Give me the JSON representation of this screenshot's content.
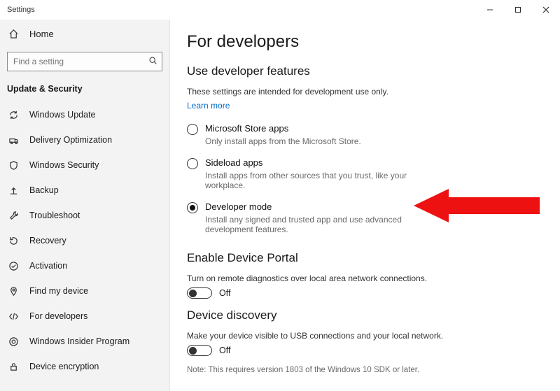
{
  "app_title": "Settings",
  "home_label": "Home",
  "search_placeholder": "Find a setting",
  "category": "Update & Security",
  "sidebar_items": [
    {
      "id": "windows-update",
      "label": "Windows Update"
    },
    {
      "id": "delivery-optimization",
      "label": "Delivery Optimization"
    },
    {
      "id": "windows-security",
      "label": "Windows Security"
    },
    {
      "id": "backup",
      "label": "Backup"
    },
    {
      "id": "troubleshoot",
      "label": "Troubleshoot"
    },
    {
      "id": "recovery",
      "label": "Recovery"
    },
    {
      "id": "activation",
      "label": "Activation"
    },
    {
      "id": "find-my-device",
      "label": "Find my device"
    },
    {
      "id": "for-developers",
      "label": "For developers"
    },
    {
      "id": "windows-insider",
      "label": "Windows Insider Program"
    },
    {
      "id": "device-encryption",
      "label": "Device encryption"
    }
  ],
  "page": {
    "title": "For developers",
    "dev_features": {
      "heading": "Use developer features",
      "desc": "These settings are intended for development use only.",
      "link": "Learn more",
      "options": [
        {
          "id": "ms-store",
          "label": "Microsoft Store apps",
          "desc": "Only install apps from the Microsoft Store.",
          "selected": false
        },
        {
          "id": "sideload",
          "label": "Sideload apps",
          "desc": "Install apps from other sources that you trust, like your workplace.",
          "selected": false
        },
        {
          "id": "dev-mode",
          "label": "Developer mode",
          "desc": "Install any signed and trusted app and use advanced development features.",
          "selected": true
        }
      ]
    },
    "device_portal": {
      "heading": "Enable Device Portal",
      "desc": "Turn on remote diagnostics over local area network connections.",
      "toggle_state": "Off"
    },
    "device_discovery": {
      "heading": "Device discovery",
      "desc": "Make your device visible to USB connections and your local network.",
      "toggle_state": "Off",
      "note": "Note: This requires version 1803 of the Windows 10 SDK or later."
    }
  }
}
